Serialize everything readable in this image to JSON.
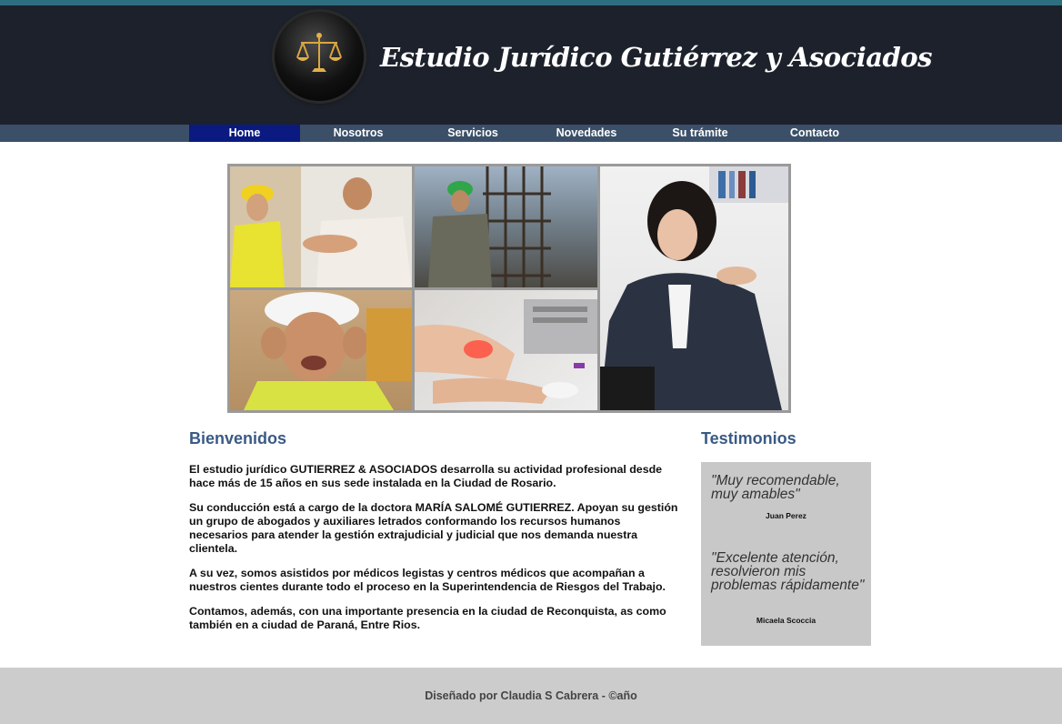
{
  "header": {
    "title": "Estudio Jurídico Gutiérrez y Asociados",
    "logo_icon": "scales-of-justice-icon"
  },
  "nav": {
    "items": [
      {
        "label": "Home",
        "active": true
      },
      {
        "label": "Nosotros",
        "active": false
      },
      {
        "label": "Servicios",
        "active": false
      },
      {
        "label": "Novedades",
        "active": false
      },
      {
        "label": "Su trámite",
        "active": false
      },
      {
        "label": "Contacto",
        "active": false
      }
    ]
  },
  "main": {
    "welcome_title": "Bienvenidos",
    "paragraphs": [
      "El estudio jurídico GUTIERREZ & ASOCIADOS desarrolla su actividad profesional desde hace más de 15 años en sus sede instalada en la Ciudad de Rosario.",
      "Su conducción está a cargo de la doctora MARÍA SALOMÉ GUTIERREZ. Apoyan su gestión un grupo de abogados y auxiliares letrados conformando los recursos humanos necesarios para atender la gestión extrajudicial y judicial que nos demanda nuestra clientela.",
      "A su vez, somos asistidos por médicos legistas y centros médicos que acompañan a nuestros cientes durante todo el proceso en la Superintendencia de Riesgos del Trabajo.",
      "Contamos, además, con una importante presencia en la ciudad de Reconquista, as como también en a ciudad de Paraná, Entre Rios."
    ]
  },
  "testimonials": {
    "title": "Testimonios",
    "items": [
      {
        "quote": "\"Muy recomendable, muy amables\"",
        "author": "Juan Perez"
      },
      {
        "quote": "\"Excelente atención, resolvieron mis problemas rápidamente\"",
        "author": "Micaela Scoccia"
      }
    ]
  },
  "footer": {
    "text": "Diseñado por Claudia S Cabrera - ©año"
  },
  "colors": {
    "header_bg": "#1c212b",
    "top_accent": "#2d6f80",
    "nav_bg": "#3b5068",
    "nav_active": "#0b1a80",
    "heading": "#3a5a85",
    "footer_bg": "#cccccc"
  }
}
